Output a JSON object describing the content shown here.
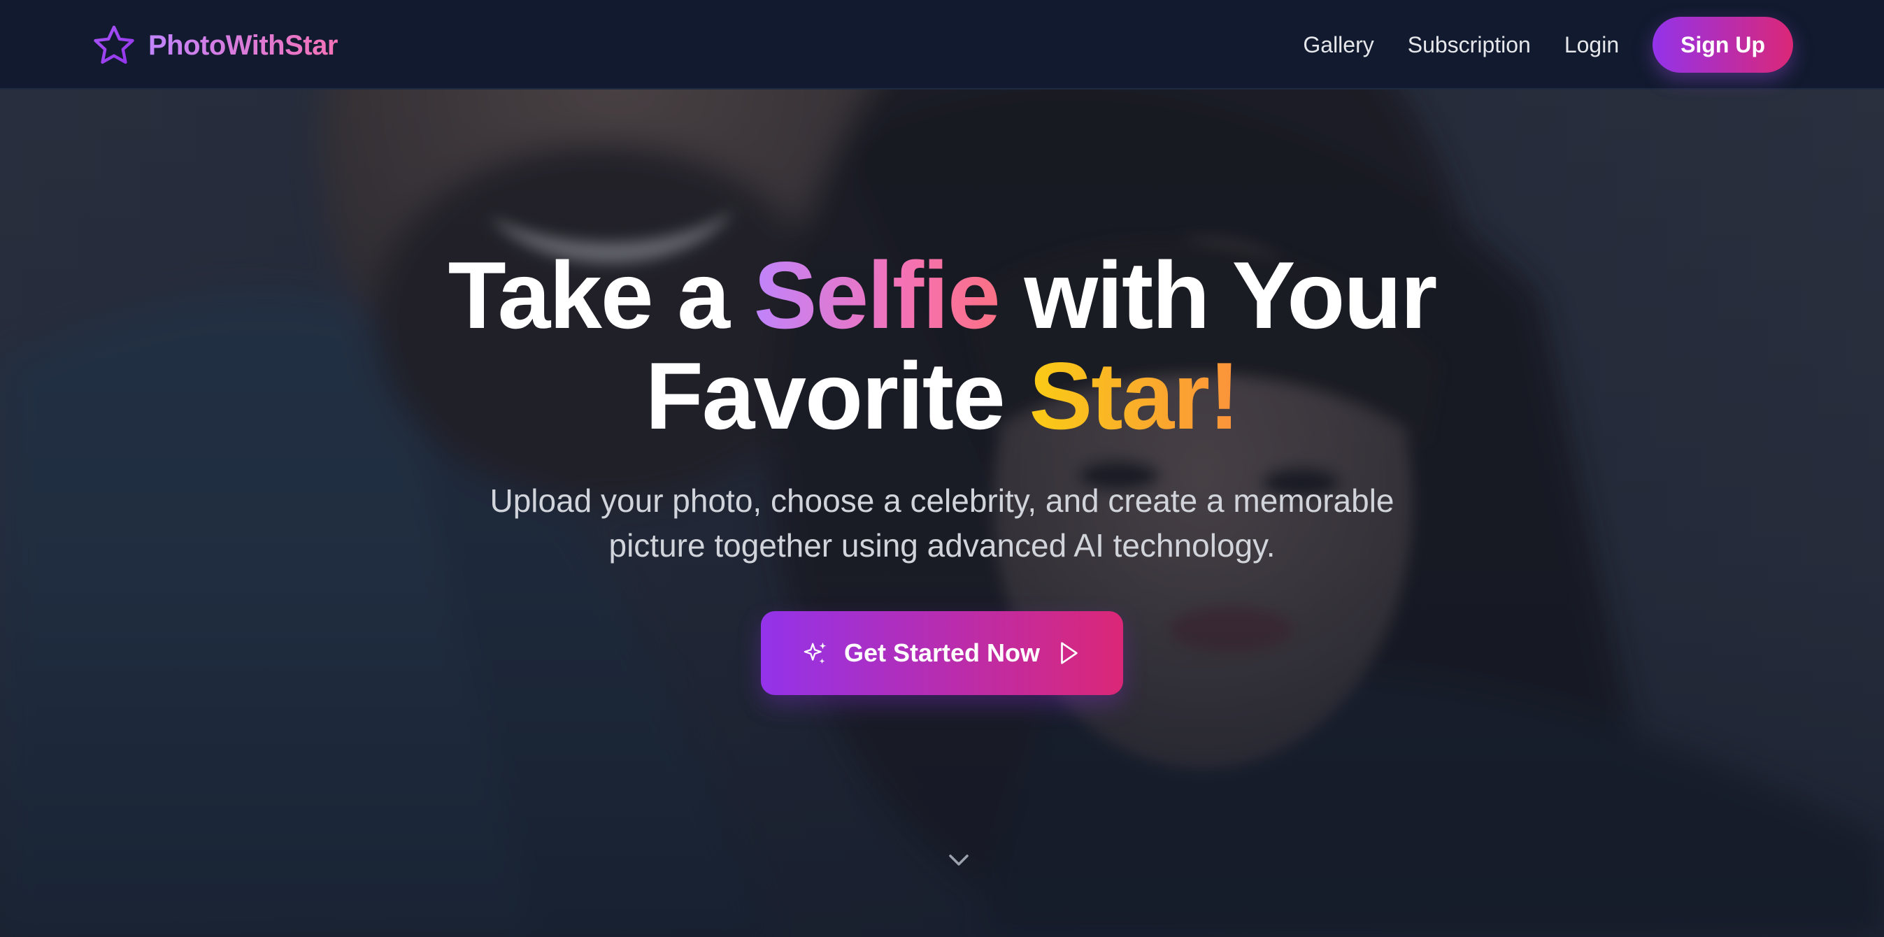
{
  "colors": {
    "page_background": "#111827",
    "nav_background": "#111a2e",
    "brand_gradient": [
      "#c084fc",
      "#f472b6"
    ],
    "button_gradient": [
      "#9333ea",
      "#db2777"
    ],
    "selfie_gradient": [
      "#c084fc",
      "#f472b6",
      "#fb7185"
    ],
    "star_gradient": [
      "#facc15",
      "#fb923c"
    ],
    "nav_text": "#e5e7eb",
    "subtitle_text": "#d1d5db"
  },
  "header": {
    "brand": {
      "icon": "star-outline-icon",
      "name": "PhotoWithStar"
    },
    "nav": [
      {
        "label": "Gallery"
      },
      {
        "label": "Subscription"
      },
      {
        "label": "Login"
      }
    ],
    "signup_label": "Sign Up"
  },
  "hero": {
    "background_image": "couple-portrait-photo",
    "title": {
      "line1_before": "Take a",
      "line1_highlight": "Selfie",
      "line1_after": "with Your",
      "line2_before": "Favorite",
      "line2_highlight": "Star!"
    },
    "subtitle": "Upload your photo, choose a celebrity, and create a memorable picture together using advanced AI technology.",
    "cta": {
      "label": "Get Started Now",
      "icon_left": "sparkles-icon",
      "icon_right": "play-outline-icon"
    },
    "scroll_indicator": "chevron-down-icon"
  }
}
